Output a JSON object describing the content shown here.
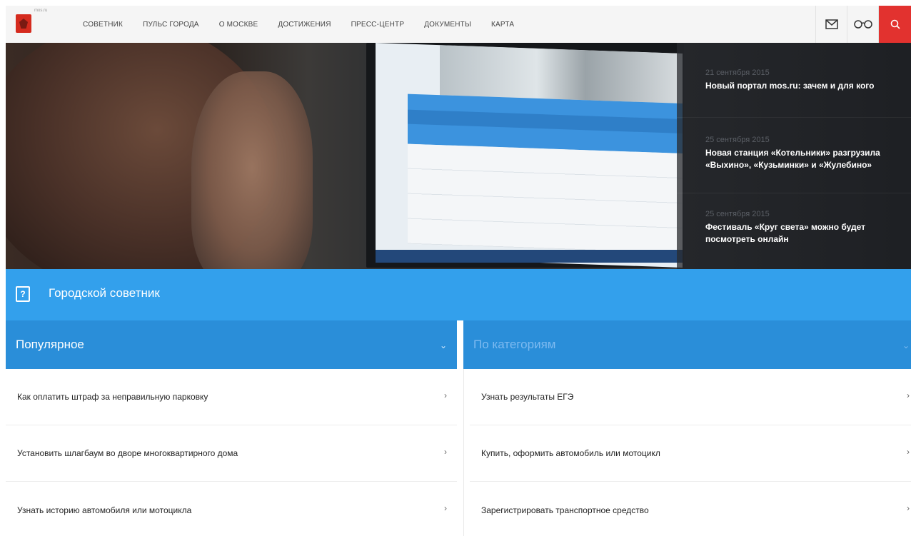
{
  "nav": {
    "logo_caption": "mos.ru",
    "items": [
      {
        "label": "СОВЕТНИК"
      },
      {
        "label": "ПУЛЬС ГОРОДА"
      },
      {
        "label": "О МОСКВЕ"
      },
      {
        "label": "ДОСТИЖЕНИЯ"
      },
      {
        "label": "ПРЕСС-ЦЕНТР"
      },
      {
        "label": "ДОКУМЕНТЫ"
      },
      {
        "label": "КАРТА"
      }
    ],
    "icons": [
      "mail-icon",
      "glasses-icon",
      "search-icon"
    ],
    "accent_color": "#e2322f"
  },
  "news": [
    {
      "date": "21 сентября 2015",
      "title": "Новый портал mos.ru: зачем и для кого"
    },
    {
      "date": "25 сентября 2015",
      "title": "Новая станция «Котельники» разгрузила «Выхино», «Кузьминки» и «Жулебино»"
    },
    {
      "date": "25 сентября 2015",
      "title": "Фестиваль «Круг света» можно будет посмотреть онлайн"
    }
  ],
  "advisor": {
    "icon": "question-icon",
    "title": "Городской советник",
    "color": "#33a0ec"
  },
  "tabs": [
    {
      "label": "Популярное",
      "active": true
    },
    {
      "label": "По категориям",
      "active": false
    }
  ],
  "popular": [
    {
      "label": "Как оплатить штраф за неправильную парковку"
    },
    {
      "label": "Установить шлагбаум во дворе многоквартирного дома"
    },
    {
      "label": "Узнать историю автомобиля или мотоцикла"
    }
  ],
  "categories": [
    {
      "label": "Узнать результаты ЕГЭ"
    },
    {
      "label": "Купить, оформить автомобиль или мотоцикл"
    },
    {
      "label": "Зарегистрировать транспортное средство"
    }
  ]
}
